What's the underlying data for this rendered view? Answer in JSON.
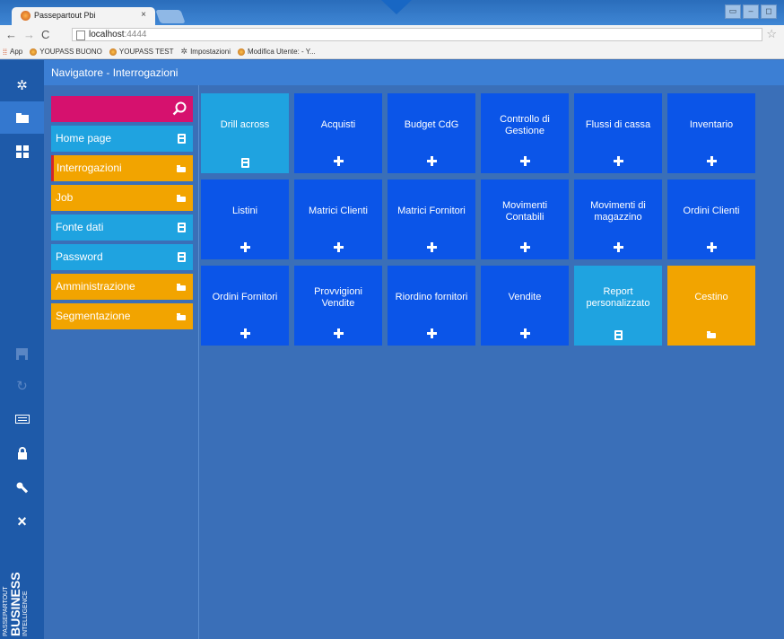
{
  "browser": {
    "tab_title": "Passepartout Pbi",
    "tab_close": "×",
    "url_host": "localhost",
    "url_port": ":4444",
    "window_buttons": [
      "▭",
      "–",
      "◻"
    ],
    "bookmarks": [
      {
        "label": "App",
        "icon": "apps-grid-icon"
      },
      {
        "label": "YOUPASS BUONO",
        "icon": "favicon"
      },
      {
        "label": "YOUPASS TEST",
        "icon": "favicon"
      },
      {
        "label": "Impostazioni",
        "icon": "gear-icon"
      },
      {
        "label": "Modifica Utente: - Y...",
        "icon": "favicon"
      }
    ]
  },
  "app": {
    "header_title": "Navigatore - Interrogazioni",
    "logo": {
      "line1": "PASSEPARTOUT",
      "line2": "BUSINESS",
      "line3": "INTELLIGENCE"
    },
    "rail_icons": [
      "gear-icon",
      "folder-icon",
      "tiles-icon",
      "save-icon",
      "refresh-icon",
      "keyboard-icon",
      "lock-icon",
      "wrench-icon",
      "close-icon"
    ],
    "search_placeholder": "",
    "menu": [
      {
        "label": "Home page",
        "color": "blue",
        "icon": "document-icon"
      },
      {
        "label": "Interrogazioni",
        "color": "orange",
        "icon": "folder-icon",
        "selected": true
      },
      {
        "label": "Job",
        "color": "orange",
        "icon": "folder-icon"
      },
      {
        "label": "Fonte dati",
        "color": "blue",
        "icon": "document-icon"
      },
      {
        "label": "Password",
        "color": "blue",
        "icon": "document-icon"
      },
      {
        "label": "Amministrazione",
        "color": "orange",
        "icon": "folder-icon"
      },
      {
        "label": "Segmentazione",
        "color": "orange",
        "icon": "folder-icon"
      }
    ],
    "tiles": [
      {
        "label": "Drill across",
        "color": "light",
        "icon": "document-icon"
      },
      {
        "label": "Acquisti",
        "color": "blue",
        "icon": "plus-icon"
      },
      {
        "label": "Budget CdG",
        "color": "blue",
        "icon": "plus-icon"
      },
      {
        "label": "Controllo di Gestione",
        "color": "blue",
        "icon": "plus-icon"
      },
      {
        "label": "Flussi di cassa",
        "color": "blue",
        "icon": "plus-icon"
      },
      {
        "label": "Inventario",
        "color": "blue",
        "icon": "plus-icon"
      },
      {
        "label": "Listini",
        "color": "blue",
        "icon": "plus-icon"
      },
      {
        "label": "Matrici Clienti",
        "color": "blue",
        "icon": "plus-icon"
      },
      {
        "label": "Matrici Fornitori",
        "color": "blue",
        "icon": "plus-icon"
      },
      {
        "label": "Movimenti Contabili",
        "color": "blue",
        "icon": "plus-icon"
      },
      {
        "label": "Movimenti di magazzino",
        "color": "blue",
        "icon": "plus-icon"
      },
      {
        "label": "Ordini Clienti",
        "color": "blue",
        "icon": "plus-icon"
      },
      {
        "label": "Ordini Fornitori",
        "color": "blue",
        "icon": "plus-icon"
      },
      {
        "label": "Provvigioni Vendite",
        "color": "blue",
        "icon": "plus-icon"
      },
      {
        "label": "Riordino fornitori",
        "color": "blue",
        "icon": "plus-icon"
      },
      {
        "label": "Vendite",
        "color": "blue",
        "icon": "plus-icon"
      },
      {
        "label": "Report personalizzato",
        "color": "light",
        "icon": "document-icon"
      },
      {
        "label": "Cestino",
        "color": "orange",
        "icon": "folder-icon"
      }
    ],
    "colors": {
      "tile_blue": "#0b55e8",
      "tile_light": "#1fa3e0",
      "orange": "#f2a400",
      "search": "#d6116e",
      "background": "#3a6fb8"
    }
  }
}
